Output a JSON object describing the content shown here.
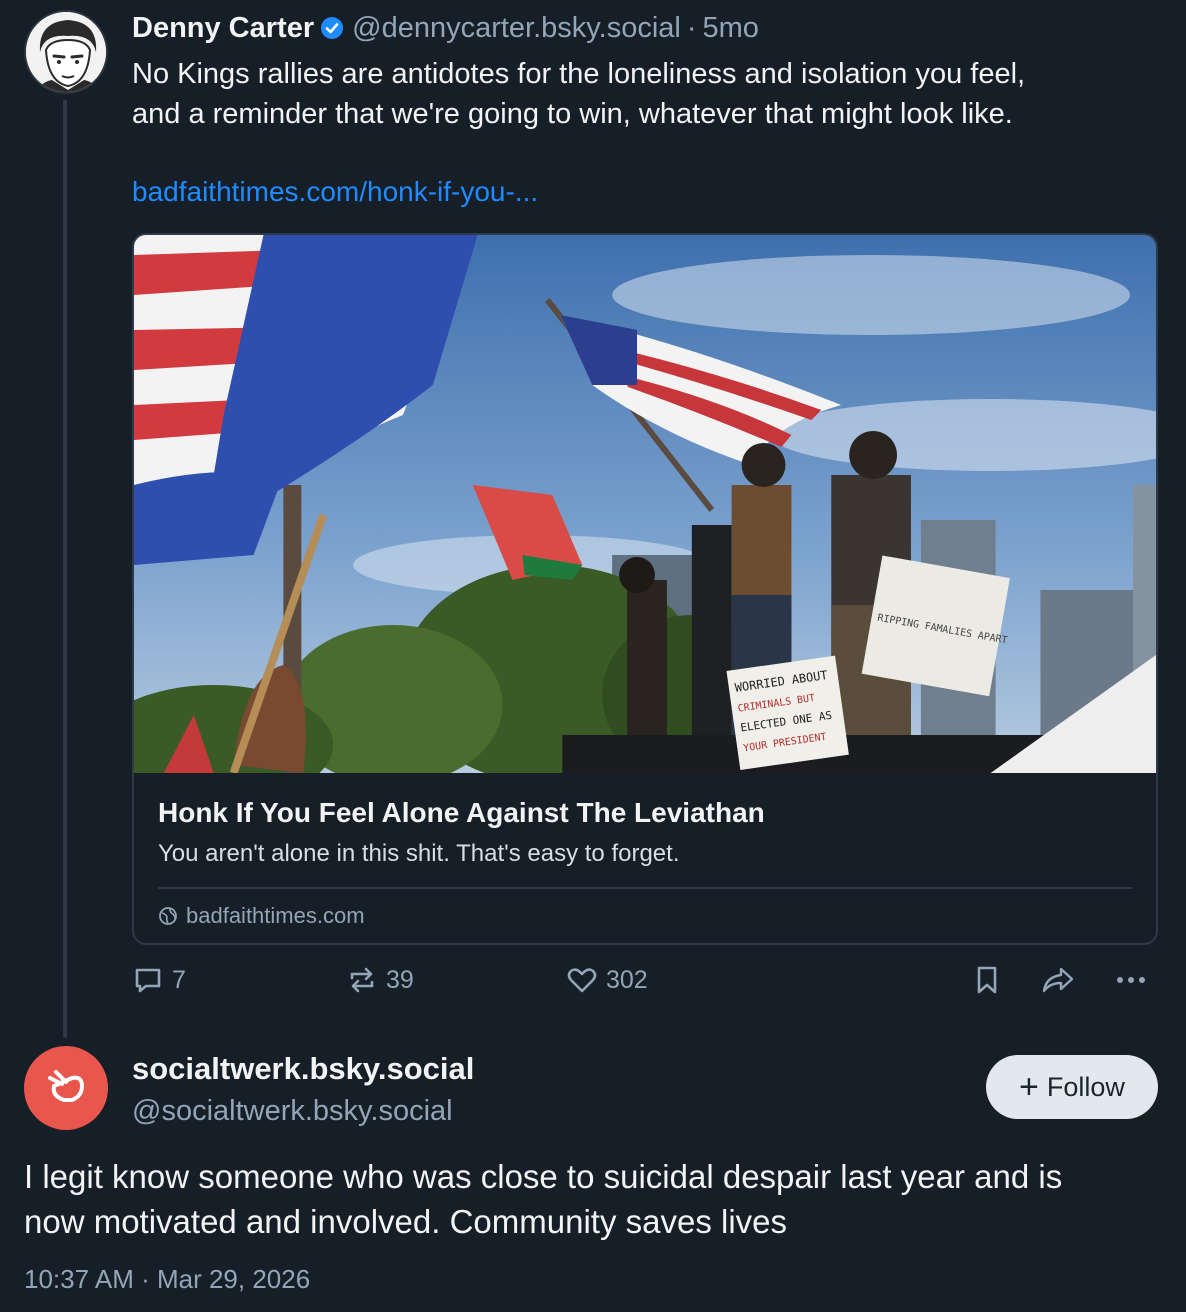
{
  "post": {
    "author_name": "Denny Carter",
    "handle": "@dennycarter.bsky.social",
    "separator": "·",
    "age": "5mo",
    "text_line1": "No Kings rallies are antidotes for the loneliness and isolation you feel,",
    "text_line2": "and a reminder that we're going to win, whatever that might look like.",
    "link_text": "badfaithtimes.com/honk-if-you-...",
    "card": {
      "title": "Honk If You Feel Alone Against The Leviathan",
      "description": "You aren't alone in this shit. That's easy to forget.",
      "domain": "badfaithtimes.com",
      "photo_signs": {
        "sign1": "WORRIED ABOUT",
        "sign2": "CRIMINALS BUT",
        "sign3": "ELECTED ONE AS",
        "sign4": "YOUR PRESIDENT",
        "sign5": "RIPPING FAMALIES APART"
      }
    },
    "stats": {
      "replies": "7",
      "reposts": "39",
      "likes": "302"
    }
  },
  "reply": {
    "display_name": "socialtwerk.bsky.social",
    "handle": "@socialtwerk.bsky.social",
    "follow_label": "Follow",
    "text_line1": "I legit know someone who was close to suicidal despair last year and is",
    "text_line2": "now motivated and involved. Community saves lives",
    "timestamp": "10:37 AM · Mar 29, 2026"
  },
  "colors": {
    "background": "#161e27",
    "link": "#208bfe",
    "muted": "#93a5b7",
    "verified": "#208bfe",
    "reply_avatar": "#e8564d"
  },
  "icons": [
    "verified-badge-icon",
    "globe-icon",
    "reply-icon",
    "repost-icon",
    "like-icon",
    "bookmark-icon",
    "share-icon",
    "more-icon",
    "hand-logo-icon"
  ]
}
